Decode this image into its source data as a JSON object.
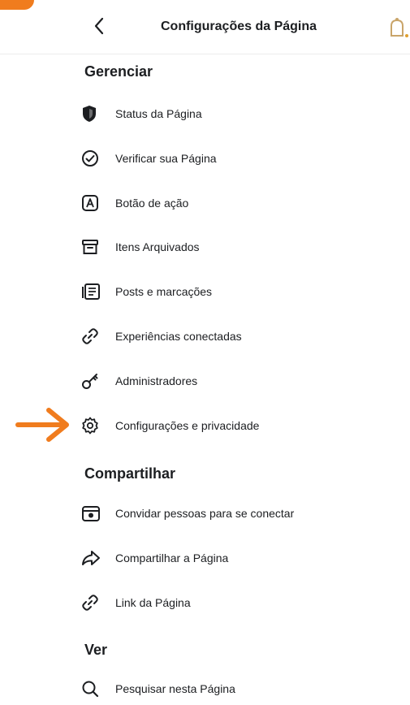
{
  "header": {
    "title": "Configurações da Página",
    "back_icon": "chevron-left-icon",
    "right_icon": "notification-icon"
  },
  "sections": [
    {
      "title": "Gerenciar",
      "items": [
        {
          "label": "Status da Página",
          "icon": "shield-icon"
        },
        {
          "label": "Verificar sua Página",
          "icon": "verified-check-icon"
        },
        {
          "label": "Botão de ação",
          "icon": "action-button-icon"
        },
        {
          "label": "Itens Arquivados",
          "icon": "archive-icon"
        },
        {
          "label": "Posts e marcações",
          "icon": "posts-tags-icon"
        },
        {
          "label": "Experiências conectadas",
          "icon": "link-icon"
        },
        {
          "label": "Administradores",
          "icon": "key-icon"
        },
        {
          "label": "Configurações e privacidade",
          "icon": "gear-icon"
        }
      ]
    },
    {
      "title": "Compartilhar",
      "items": [
        {
          "label": "Convidar pessoas para se conectar",
          "icon": "invite-icon"
        },
        {
          "label": "Compartilhar a Página",
          "icon": "share-icon"
        },
        {
          "label": "Link da Página",
          "icon": "link-icon"
        }
      ]
    },
    {
      "title": "Ver",
      "items": [
        {
          "label": "Pesquisar nesta Página",
          "icon": "search-icon"
        }
      ]
    }
  ],
  "colors": {
    "accent": "#f07c1e",
    "text": "#1c1e21",
    "icon": "#1c1e21",
    "divider": "#ececec"
  }
}
